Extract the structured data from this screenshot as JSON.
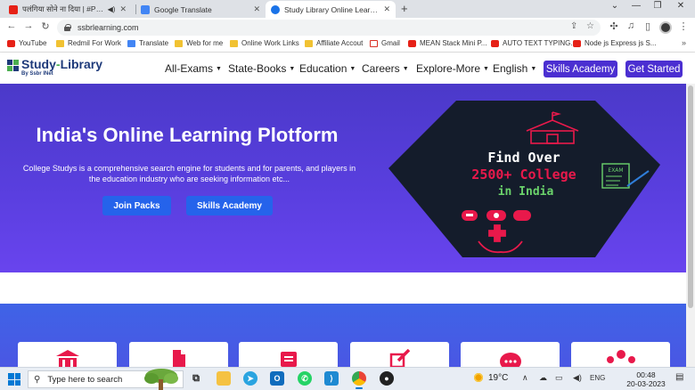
{
  "browser": {
    "tabs": [
      {
        "title": "पलंगिया सोने ना दिया | #Pawan",
        "favicon_color": "#e62117",
        "active": false,
        "has_audio": true
      },
      {
        "title": "Google Translate",
        "favicon_color": "#4285f4",
        "active": false,
        "has_audio": false
      },
      {
        "title": "Study Library Online Learning",
        "favicon_color": "#1a73e8",
        "active": true,
        "has_audio": false
      }
    ],
    "url": "ssbrlearning.com",
    "bookmarks": [
      {
        "label": "YouTube",
        "icon": "youtube-icon"
      },
      {
        "label": "Redmil For Work",
        "icon": "folder-icon"
      },
      {
        "label": "Translate",
        "icon": "google-translate-icon"
      },
      {
        "label": "Web for me",
        "icon": "folder-icon"
      },
      {
        "label": "Online Work Links",
        "icon": "folder-icon"
      },
      {
        "label": "Affiliate Accout",
        "icon": "folder-icon"
      },
      {
        "label": "Gmail",
        "icon": "gmail-icon"
      },
      {
        "label": "MEAN Stack Mini P...",
        "icon": "youtube-icon"
      },
      {
        "label": "AUTO TEXT TYPING...",
        "icon": "youtube-icon"
      },
      {
        "label": "Node js Express js S...",
        "icon": "youtube-icon"
      }
    ],
    "bookmarks_more": "»"
  },
  "site": {
    "logo": {
      "part1": "Study",
      "dash": "-",
      "part2": "Library",
      "sub": "By Ssbr INet"
    },
    "nav": [
      {
        "label": "All-Exams",
        "has_caret": true
      },
      {
        "label": "State-Books",
        "has_caret": true
      },
      {
        "label": "Education",
        "has_caret": true
      },
      {
        "label": "Careers",
        "has_caret": true
      },
      {
        "label": "Explore-More",
        "has_caret": true
      },
      {
        "label": "English",
        "has_caret": true
      }
    ],
    "header_buttons": [
      "Skills Academy",
      "Get Started"
    ],
    "hero": {
      "title": "India's Online Learning Plotform",
      "description": "College Studys is a comprehensive search engine for students and for parents, and players in the education industry who are seeking information etc...",
      "buttons": [
        "Join Packs",
        "Skills Academy"
      ]
    },
    "promo": {
      "line1": "Find Over",
      "line2": "2500+ College",
      "line3": "in India",
      "exam_icon_text": "EXAM"
    },
    "colors": {
      "brand": "#4b2fd1",
      "hero_bg": "#5a3fe0",
      "hero_button": "#2563eb",
      "promo_red": "#e8194b",
      "promo_green": "#6bd36b"
    }
  },
  "taskbar": {
    "search_placeholder": "Type here to search",
    "weather": "19°C",
    "language": "ENG",
    "time": "00:48",
    "date": "20-03-2023"
  }
}
